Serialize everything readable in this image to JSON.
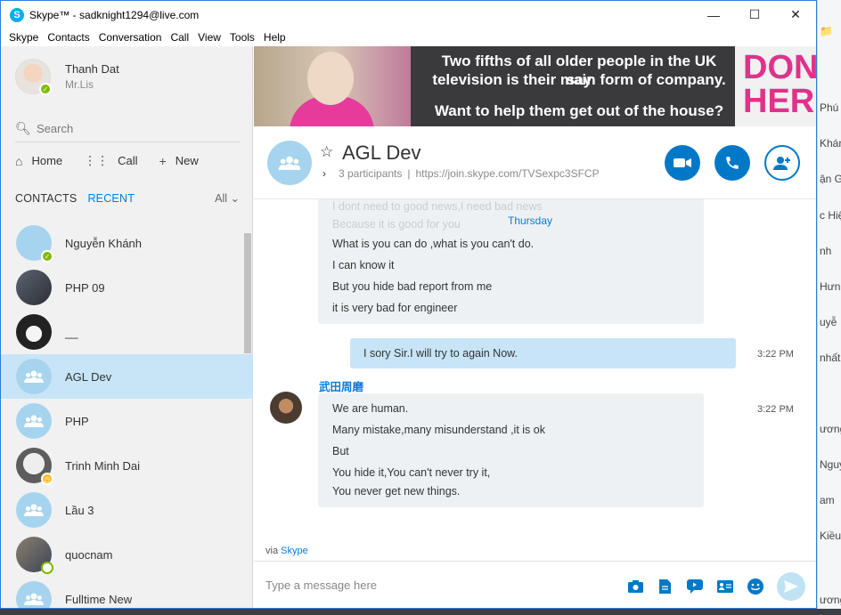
{
  "window": {
    "title": "Skype™ - sadknight1294@live.com",
    "controls": [
      "minimize",
      "maximize",
      "close"
    ]
  },
  "menu": [
    "Skype",
    "Contacts",
    "Conversation",
    "Call",
    "View",
    "Tools",
    "Help"
  ],
  "profile": {
    "name": "Thanh Dat",
    "mood": "Mr.Lis"
  },
  "search": {
    "placeholder": "Search"
  },
  "nav": {
    "home": "Home",
    "call": "Call",
    "new": "New"
  },
  "tabs": {
    "contacts": "CONTACTS",
    "recent": "RECENT",
    "filter": "All"
  },
  "contacts": [
    {
      "name": "Nguyễn Khánh",
      "status": "online"
    },
    {
      "name": "PHP 09",
      "status": ""
    },
    {
      "name": "__",
      "status": ""
    },
    {
      "name": "AGL Dev",
      "status": "",
      "selected": true
    },
    {
      "name": "PHP",
      "status": ""
    },
    {
      "name": "Trinh Minh Dai",
      "status": "away"
    },
    {
      "name": "Lầu 3",
      "status": ""
    },
    {
      "name": "quocnam",
      "status": "online"
    },
    {
      "name": "Fulltime New",
      "status": ""
    }
  ],
  "ad": {
    "line1": "Two fifths of all older people in the UK say",
    "line2": "television is their main form of company.",
    "line3": "Want to help them get out of the house?",
    "cta1": "DONA",
    "cta2": "HERE"
  },
  "conversation": {
    "title": "AGL Dev",
    "participants": "3 participants",
    "link": "https://join.skype.com/TVSexpc3SFCP"
  },
  "messages": {
    "ghost1": "I dont need to good news,I need bad news",
    "ghost2": "Because it  is good for you",
    "day": "Thursday",
    "first": [
      "What is you can do ,what is you can't do.",
      "I can know it",
      "But you hide bad report from me",
      "it is very bad for engineer"
    ],
    "mine": "I sory Sir.I will try to again Now.",
    "mine_time": "3:22 PM",
    "sender": "武田周磨",
    "second": [
      "We are human.",
      "Many mistake,many misunderstand ,it is ok",
      "But",
      "You hide it,You can't never try it,",
      "You never get new things."
    ],
    "second_time": "3:22 PM"
  },
  "footer": {
    "via_prefix": "via",
    "via_link": "Skype",
    "placeholder": "Type a message here"
  },
  "background_fragments": [
    "Phú",
    "Khán",
    "ận G",
    "c Hiệ",
    "nh",
    "Hưn",
    "uyễ",
    "nhất",
    "ương",
    "Nguye",
    "am",
    "Kiều",
    "ương"
  ],
  "colors": {
    "accent": "#0078c8",
    "selected": "#c7e5f7",
    "online": "#7fba00",
    "away": "#fdb913",
    "ad_cta": "#e0328a"
  }
}
